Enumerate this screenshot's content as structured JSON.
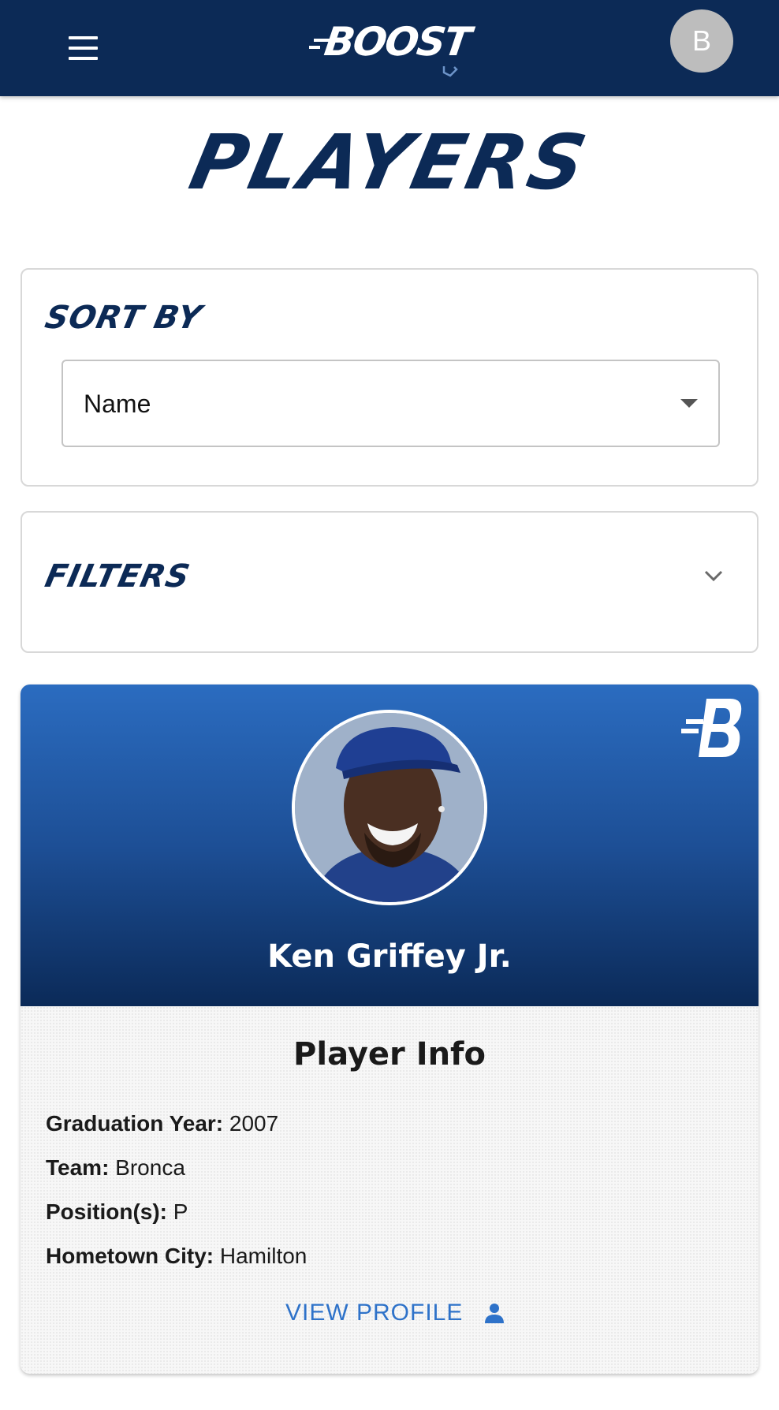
{
  "header": {
    "logo_text": "BOOST",
    "avatar_initial": "B"
  },
  "page": {
    "title": "PLAYERS"
  },
  "sort": {
    "heading": "SORT BY",
    "selected": "Name"
  },
  "filters": {
    "heading": "FILTERS"
  },
  "player_card": {
    "name": "Ken Griffey Jr.",
    "info_title": "Player Info",
    "fields": [
      {
        "label": "Graduation Year:",
        "value": "2007"
      },
      {
        "label": "Team:",
        "value": "Bronca"
      },
      {
        "label": "Position(s):",
        "value": "P"
      },
      {
        "label": "Hometown City:",
        "value": "Hamilton"
      }
    ],
    "action_label": "VIEW PROFILE"
  },
  "colors": {
    "navy": "#0c2a56",
    "accent_blue": "#2e72c9",
    "card_gradient_top": "#2b6cc0",
    "avatar_gray": "#bdbdbd"
  },
  "icons": {
    "menu": "hamburger-menu-icon",
    "select": "dropdown-arrow-icon",
    "filters": "chevron-down-icon",
    "profile": "person-icon",
    "card_logo": "boost-b-logo"
  }
}
